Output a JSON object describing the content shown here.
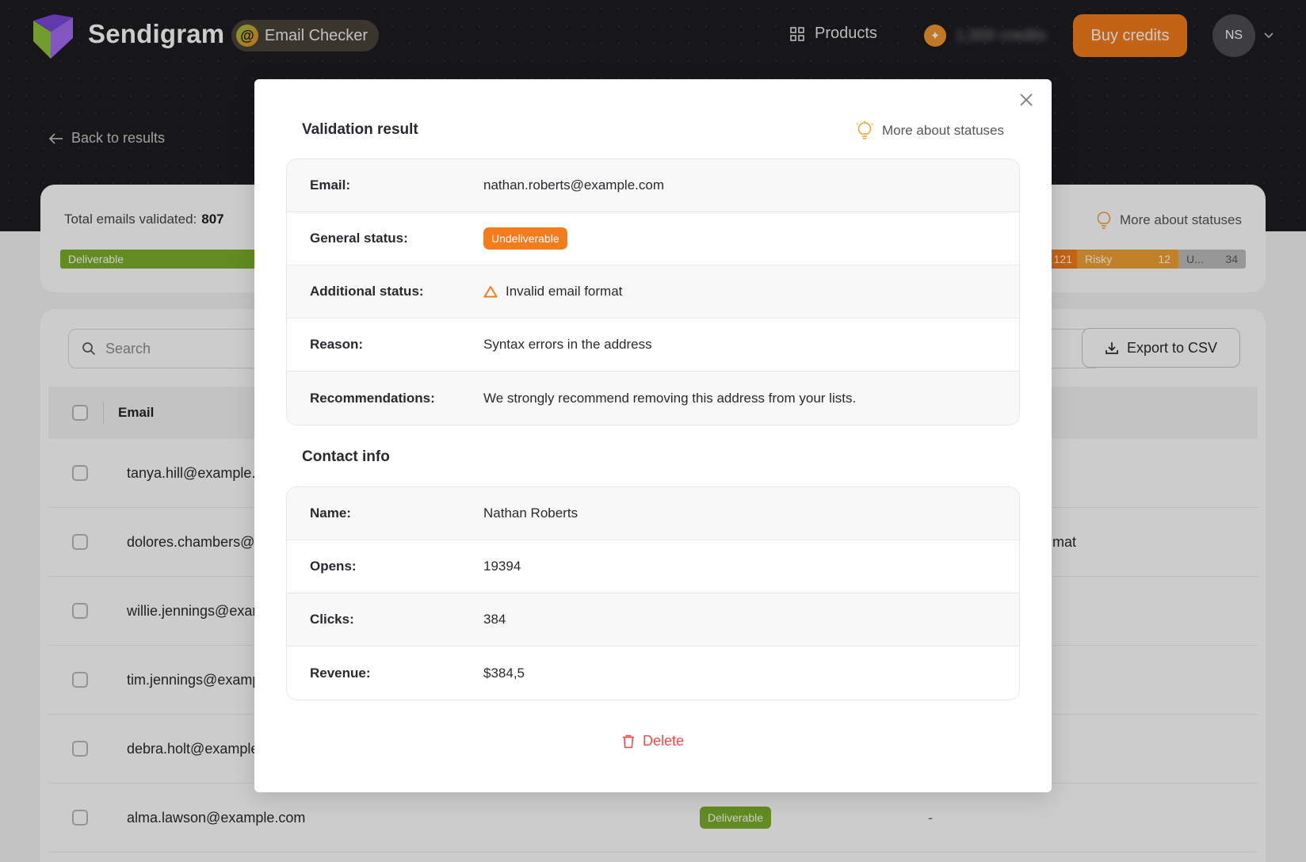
{
  "nav": {
    "brand": "Sendigram",
    "app_name": "Email Checker",
    "app_icon_glyph": "@",
    "products_label": "Products",
    "credits_amount": "1,000 credits",
    "buy_credits_label": "Buy credits",
    "avatar_initials": "NS"
  },
  "page": {
    "back_label": "Back to results",
    "total_label": "Total emails validated:",
    "total_value": "807",
    "more_about_statuses": "More about statuses",
    "status_bar": {
      "deliverable_label": "Deliverable",
      "undeliverable_count": "121",
      "risky_label": "Risky",
      "risky_count": "12",
      "unknown_label": "U...",
      "unknown_count": "34"
    },
    "search_placeholder": "Search",
    "export_label": "Export to CSV",
    "table_header_email": "Email",
    "rows": [
      {
        "email": "tanya.hill@example.",
        "extra": ""
      },
      {
        "email": "dolores.chambers@",
        "extra": "mat"
      },
      {
        "email": "willie.jennings@exar",
        "extra": ""
      },
      {
        "email": "tim.jennings@examp",
        "extra": ""
      },
      {
        "email": "debra.holt@example",
        "extra": ""
      },
      {
        "email": "alma.lawson@example.com",
        "status": "Deliverable",
        "dash": "-"
      }
    ]
  },
  "modal": {
    "validation_title": "Validation result",
    "more_about_statuses": "More about statuses",
    "validation": {
      "email_label": "Email:",
      "email_value": "nathan.roberts@example.com",
      "general_label": "General status:",
      "general_value": "Undeliverable",
      "additional_label": "Additional status:",
      "additional_value": "Invalid email format",
      "reason_label": "Reason:",
      "reason_value": "Syntax errors in the address",
      "recommend_label": "Recommendations:",
      "recommend_value": "We strongly recommend removing this address from your lists."
    },
    "contact_title": "Contact info",
    "contact": {
      "name_label": "Name:",
      "name_value": "Nathan Roberts",
      "opens_label": "Opens:",
      "opens_value": "19394",
      "clicks_label": "Clicks:",
      "clicks_value": "384",
      "revenue_label": "Revenue:",
      "revenue_value": "$384,5"
    },
    "delete_label": "Delete"
  },
  "colors": {
    "accent_orange": "#f47c1c",
    "deliverable_green": "#7bb02a",
    "risky_amber": "#f0a233",
    "danger_red": "#ee4b4b"
  },
  "icons": [
    "logo-icon",
    "email-checker-icon",
    "grid-icon",
    "coin-icon",
    "chevron-down-icon",
    "arrow-left-icon",
    "lightbulb-icon",
    "search-icon",
    "download-icon",
    "close-icon",
    "warning-triangle-icon",
    "trash-icon"
  ]
}
